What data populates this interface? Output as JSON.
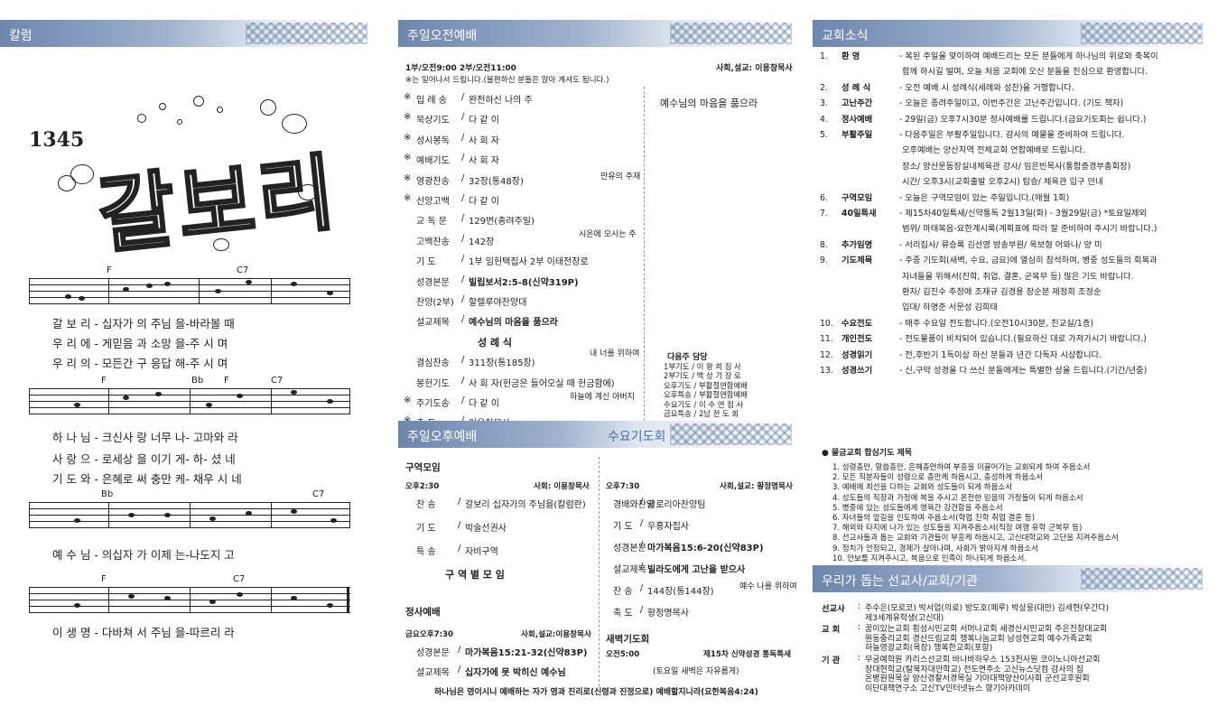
{
  "column": {
    "header": "칼럼",
    "hymn": {
      "number": "1345",
      "title": "갈보리",
      "chords": [
        "F",
        "C7",
        "F",
        "Bb",
        "F",
        "C7",
        "Bb",
        "F",
        "C7",
        "F",
        "C7"
      ],
      "lyrics": [
        "갈 보 리 - 십자가 의 주님 을-바라볼  때",
        "우 리  에 - 게믿음 과 소망  을-주 시  며",
        "우 리  의 - 모든간  구 응답  해-주 시  며",
        "하 나  님 - 크신사  랑 너무  나- 고마와  라",
        "사 랑  으 - 로세상  을 이기  게- 하- 셨  네",
        "기 도  와 - 은혜로  써 충만  케- 채우 시  네",
        "예 수  님 - 의십자  가 이제  는-나도지   고",
        "이 생  명 - 다바쳐  서 주님  을-따르리   라"
      ]
    }
  },
  "morning": {
    "header": "주일오전예배",
    "times": "1부/오전9:00  2부/오전11:00",
    "officiant": "사회,설교: 이용창목사",
    "note": "※는 일어나서 드립니다.(불편하신 분들은 앉아 계셔도 됩니다.)",
    "items": [
      {
        "m": "※",
        "name": "입 례 송",
        "val": "완전하신 나의 주"
      },
      {
        "m": "※",
        "name": "묵상기도",
        "val": "다 같 이"
      },
      {
        "m": "※",
        "name": "성시봉독",
        "val": "사 회 자"
      },
      {
        "m": "※",
        "name": "예배기도",
        "val": "사 회 자"
      },
      {
        "m": "※",
        "name": "영광찬송",
        "val": "32장(통48장)"
      },
      {
        "m": "※",
        "name": "신앙고백",
        "val": "다 같 이"
      },
      {
        "m": "",
        "name": "교 독 문",
        "val": "129번(종려주일)"
      },
      {
        "m": "",
        "name": "고백찬송",
        "val": "142장"
      },
      {
        "m": "",
        "name": "기      도",
        "val": "1부 임헌택집사   2부 이태전장로"
      },
      {
        "m": "",
        "name": "성경본문",
        "val": "빌립보서2:5-8(신약319P)"
      },
      {
        "m": "",
        "name": "찬양(2부)",
        "val": "할렐루야찬양대"
      },
      {
        "m": "",
        "name": "설교제목",
        "val": "예수님의 마음을 품으라"
      },
      {
        "m": "",
        "name": "",
        "val": "성      례      식"
      },
      {
        "m": "",
        "name": "결심찬송",
        "val": "311장(통185장)"
      },
      {
        "m": "",
        "name": "봉헌기도",
        "val": "사 회 자(헌금은 들어오실 때 헌금함에)"
      },
      {
        "m": "※",
        "name": "주기도송",
        "val": "다 같 이"
      },
      {
        "m": "※",
        "name": "축      도",
        "val": "이용창목사"
      }
    ],
    "side_title": "예수님의 마음을 품으라",
    "side_notes": [
      "만유의 주재",
      "시온에 오시는 주",
      "내 너를 위하여",
      "하늘에 계신 아버지"
    ],
    "next_title": "다음주 담당",
    "next": [
      "1부기도 / 이 왕 희 집 사",
      "2부기도 / 백 상 기 장 로",
      "오후기도 / 부활절연합예배",
      "오후특송 / 부활절연합예배",
      "수요기도 / 이 수 연 집 사",
      "금요특송 / 2남 전 도 회"
    ]
  },
  "afternoon": {
    "header": "주일오후예배",
    "group_title": "구역모임",
    "time": "오후2:30",
    "officiant": "사회: 이용창목사",
    "items": [
      {
        "name": "찬      송",
        "val": "갈보리 십자가의 주님을(칼럼란)"
      },
      {
        "name": "기      도",
        "val": "박술선권사"
      },
      {
        "name": "특      송",
        "val": "자비구역"
      }
    ],
    "center": "구  역  별  모  임",
    "friday_title": "정사예배",
    "friday_time": "금요오후7:30",
    "friday_officiant": "사회,설교:이용창목사",
    "friday_items": [
      {
        "name": "성경본문",
        "val": "마가복음15:21-32(신약83P)"
      },
      {
        "name": "설교제목",
        "val": "십자가에 못 박히신 예수님"
      }
    ]
  },
  "wednesday": {
    "header": "수요기도회",
    "time": "오후7:30",
    "officiant": "사회,설교: 황정명목사",
    "items": [
      {
        "name": "경배와찬양",
        "val": "글로리아찬양팀"
      },
      {
        "name": "기      도",
        "val": "우홍자집사"
      },
      {
        "name": "성경본문",
        "val": "마가복음15:6-20(신약83P)"
      },
      {
        "name": "설교제목",
        "val": "빌라도에게 고난을 받으사"
      },
      {
        "name": "찬      송",
        "val": "144장(통144장)"
      },
      {
        "name": "축      도",
        "val": "황정명목사"
      }
    ],
    "side_note": "예수 나를 위하여",
    "dawn_title": "새벽기도회",
    "dawn_time": "오전5:00",
    "dawn_text": "제15차 신약성경 통독특새",
    "dawn_note": "(토요일 새벽은 자유롭게)"
  },
  "footer": "하나님은 영이시니 예배하는 자가 영과 진리로(신령과 진정으로) 예배할지니라(요한복음4:24)",
  "news": {
    "header": "교회소식",
    "items": [
      {
        "n": "1.",
        "t": "환       영",
        "d": "- 복된 주일을 맞이하여 예배드리는 모든 분들에게 하나님의 위로와 축복이"
      },
      {
        "n": "",
        "t": "",
        "d": "  함께 하시길 빌며, 오늘 처음 교회에 오신 분들을 진심으로 환영합니다."
      },
      {
        "n": "2.",
        "t": "성 례 식",
        "d": "- 오전 예배 시 성례식(세례와 성찬)을 거행합니다."
      },
      {
        "n": "3.",
        "t": "고난주간",
        "d": "- 오늘은 종려주일이고, 이번주간은 고난주간입니다. (기도 책자)"
      },
      {
        "n": "4.",
        "t": "정사예배",
        "d": "- 29일(금) 오후7시30분 정사예배를 드립니다.(금요기도회는 쉽니다.)"
      },
      {
        "n": "5.",
        "t": "부활주일",
        "d": "- 다음주일은 부활주일입니다. 감사의 예물을 준비하여 드립니다."
      },
      {
        "n": "",
        "t": "",
        "d": "  오후예배는 양산지역 전체교회 연합예배로 드립니다."
      },
      {
        "n": "",
        "t": "",
        "d": "  장소/ 양산운동장실내체육관        강사/ 임은빈목사(통합증경부총회장)"
      },
      {
        "n": "",
        "t": "",
        "d": "  시간/ 오후3시(교회출발 오후2시)  탑승/ 체육관 입구 안내"
      },
      {
        "n": "6.",
        "t": "구역모임",
        "d": "- 오늘은 구역모임이 있는 주일입니다.(매월 1회)"
      },
      {
        "n": "7.",
        "t": "40일특새",
        "d": "- 제15차40일특새/신약통독 2월13일(화) - 3월29일(금)  *토요일제외"
      },
      {
        "n": "",
        "t": "",
        "d": "  범위/ 마태복음-요한계시록(계획표에 따라 잘 준비하여 주시기 바랍니다.)"
      },
      {
        "n": "8.",
        "t": "추가임명",
        "d": "- 서리집사/ 류승록 김선영    방송부원/ 옥보형    어와나/ 양  미"
      },
      {
        "n": "9.",
        "t": "기도제목",
        "d": "- 주중 기도회(새벽, 수요, 금요)에 열심히 참석하여, 병중 성도들의 회복과"
      },
      {
        "n": "",
        "t": "",
        "d": "  자녀들을 위해서(진학, 취업, 결혼, 군복무 등) 많은 기도 바랍니다."
      },
      {
        "n": "",
        "t": "",
        "d": "  환자/ 김진수 주정애 조재규 김경용 장순분 제정희 조정순"
      },
      {
        "n": "",
        "t": "",
        "d": "  입대/ 하명준 서문성 김희태"
      },
      {
        "n": "10.",
        "t": "수요전도",
        "d": "- 매주 수요일 전도합니다.(오전10시30분, 친교실/1층)"
      },
      {
        "n": "11.",
        "t": "개인전도",
        "d": "- 전도물품이 비치되어 있습니다.(필요하신 대로 가져가시기 바랍니다.)"
      },
      {
        "n": "12.",
        "t": "성경읽기",
        "d": "- 전,후반기 1독이상 하신 분들과 년간 다독자 시상합니다."
      },
      {
        "n": "13.",
        "t": "성경쓰기",
        "d": "- 신,구약 성경을 다 쓰신 분들에게는 특별한 상을 드립니다.(기간/년중)"
      }
    ]
  },
  "prayer": {
    "title": "● 물금교회 합심기도 제목",
    "items": [
      "1. 성령충만, 말씀충만, 은혜충만하여 부흥을 이끌어가는 교회되게 하여 주옵소서",
      "2. 모든 직분자들이 성령으로 충만케 하옵시고, 충성하게 하옵소서",
      "3. 예배에 최선을 다하는 교회와 성도들이 되게 하옵소서",
      "4. 성도들의 직장과 가정에 복을 주시고 온전한 믿음의 가정들이 되게 하옵소서",
      "5. 병중에 있는 성도들에게 영육간 강건함을 주옵소서",
      "6. 자녀들의 앞길을 인도하여 주옵소서(학업 진학 취업 결혼 등)",
      "7. 해외와 타지에 나가 있는 성도들을 지켜주옵소서(직장 여행 유학 군복무 등)",
      "8. 선교사들과 돕는 교회와 기관들이 부흥케 하옵시고, 고신대학교와 고단을 지켜주옵소서",
      "9. 정치가 안정되고, 경제가 살아나며, 사회가 밝아지게 하옵소서",
      "10. 안보를 지켜주시고, 복음으로 민족이 하나되게 하옵소서."
    ]
  },
  "missions": {
    "header": "우리가 돕는 선교사/교회/기관",
    "rows": [
      {
        "k": "선교사",
        "lines": [
          "주수은(모로코) 박서업(의료) 방도호(페루) 박상웅(대만) 김세현(우간다)",
          "제3세계유학생(고신대)"
        ]
      },
      {
        "k": "교     회",
        "lines": [
          "꿈이있는교회 횡성시민교회 서머나교회 새경산시민교회 주은진창대교회",
          "원동중리교회 경산드림교회 행복나눔교회 남성현교회 예수가족교회",
          "하늘영광교회(목장)  행복한교회(포항)"
        ]
      },
      {
        "k": "기     관",
        "lines": [
          "무궁예학원 카리스선교회 바나바하우스 153천사원 코이노니아선교회",
          "장대현학교(탈북자대안학교)  전도면주소 고신뉴스닷컴 감사의 집",
          "온병원원목실 양산경찰서경목실 기아대책양산이사회 군선교후원회",
          "이단대책연구소 고신TV인터넷뉴스 향기아카데미"
        ]
      }
    ]
  }
}
